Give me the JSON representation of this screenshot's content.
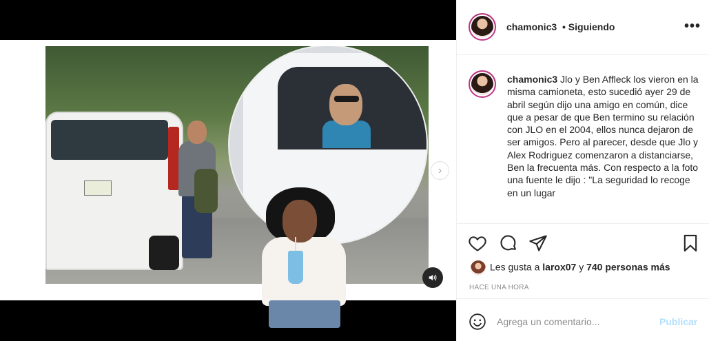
{
  "post": {
    "username": "chamonic3",
    "follow_status": "• Siguiendo",
    "more_icon": "more-options-icon",
    "caption_text": "Jlo y Ben Affleck los vieron en la misma camioneta, esto sucedió ayer 29 de abril según dijo una amigo en común, dice que a pesar de que Ben termino su relación con JLO en el 2004, ellos nunca dejaron de ser amigos. Pero al parecer, desde que Jlo y Alex Rodriguez comenzaron a distanciarse, Ben la frecuenta más. Con respecto a la foto una fuente le dijo : \"La seguridad lo recoge en un lugar",
    "likes_prefix": "Les gusta a",
    "likes_user": "larox07",
    "likes_joiner": "y",
    "likes_count": "740 personas más",
    "timestamp": "HACE UNA HORA"
  },
  "comment": {
    "placeholder": "Agrega un comentario...",
    "publish_label": "Publicar"
  },
  "colors": {
    "link_disabled": "#b2dffc",
    "muted": "#8e8e8e",
    "text": "#262626",
    "story_ring": "#c13584"
  }
}
